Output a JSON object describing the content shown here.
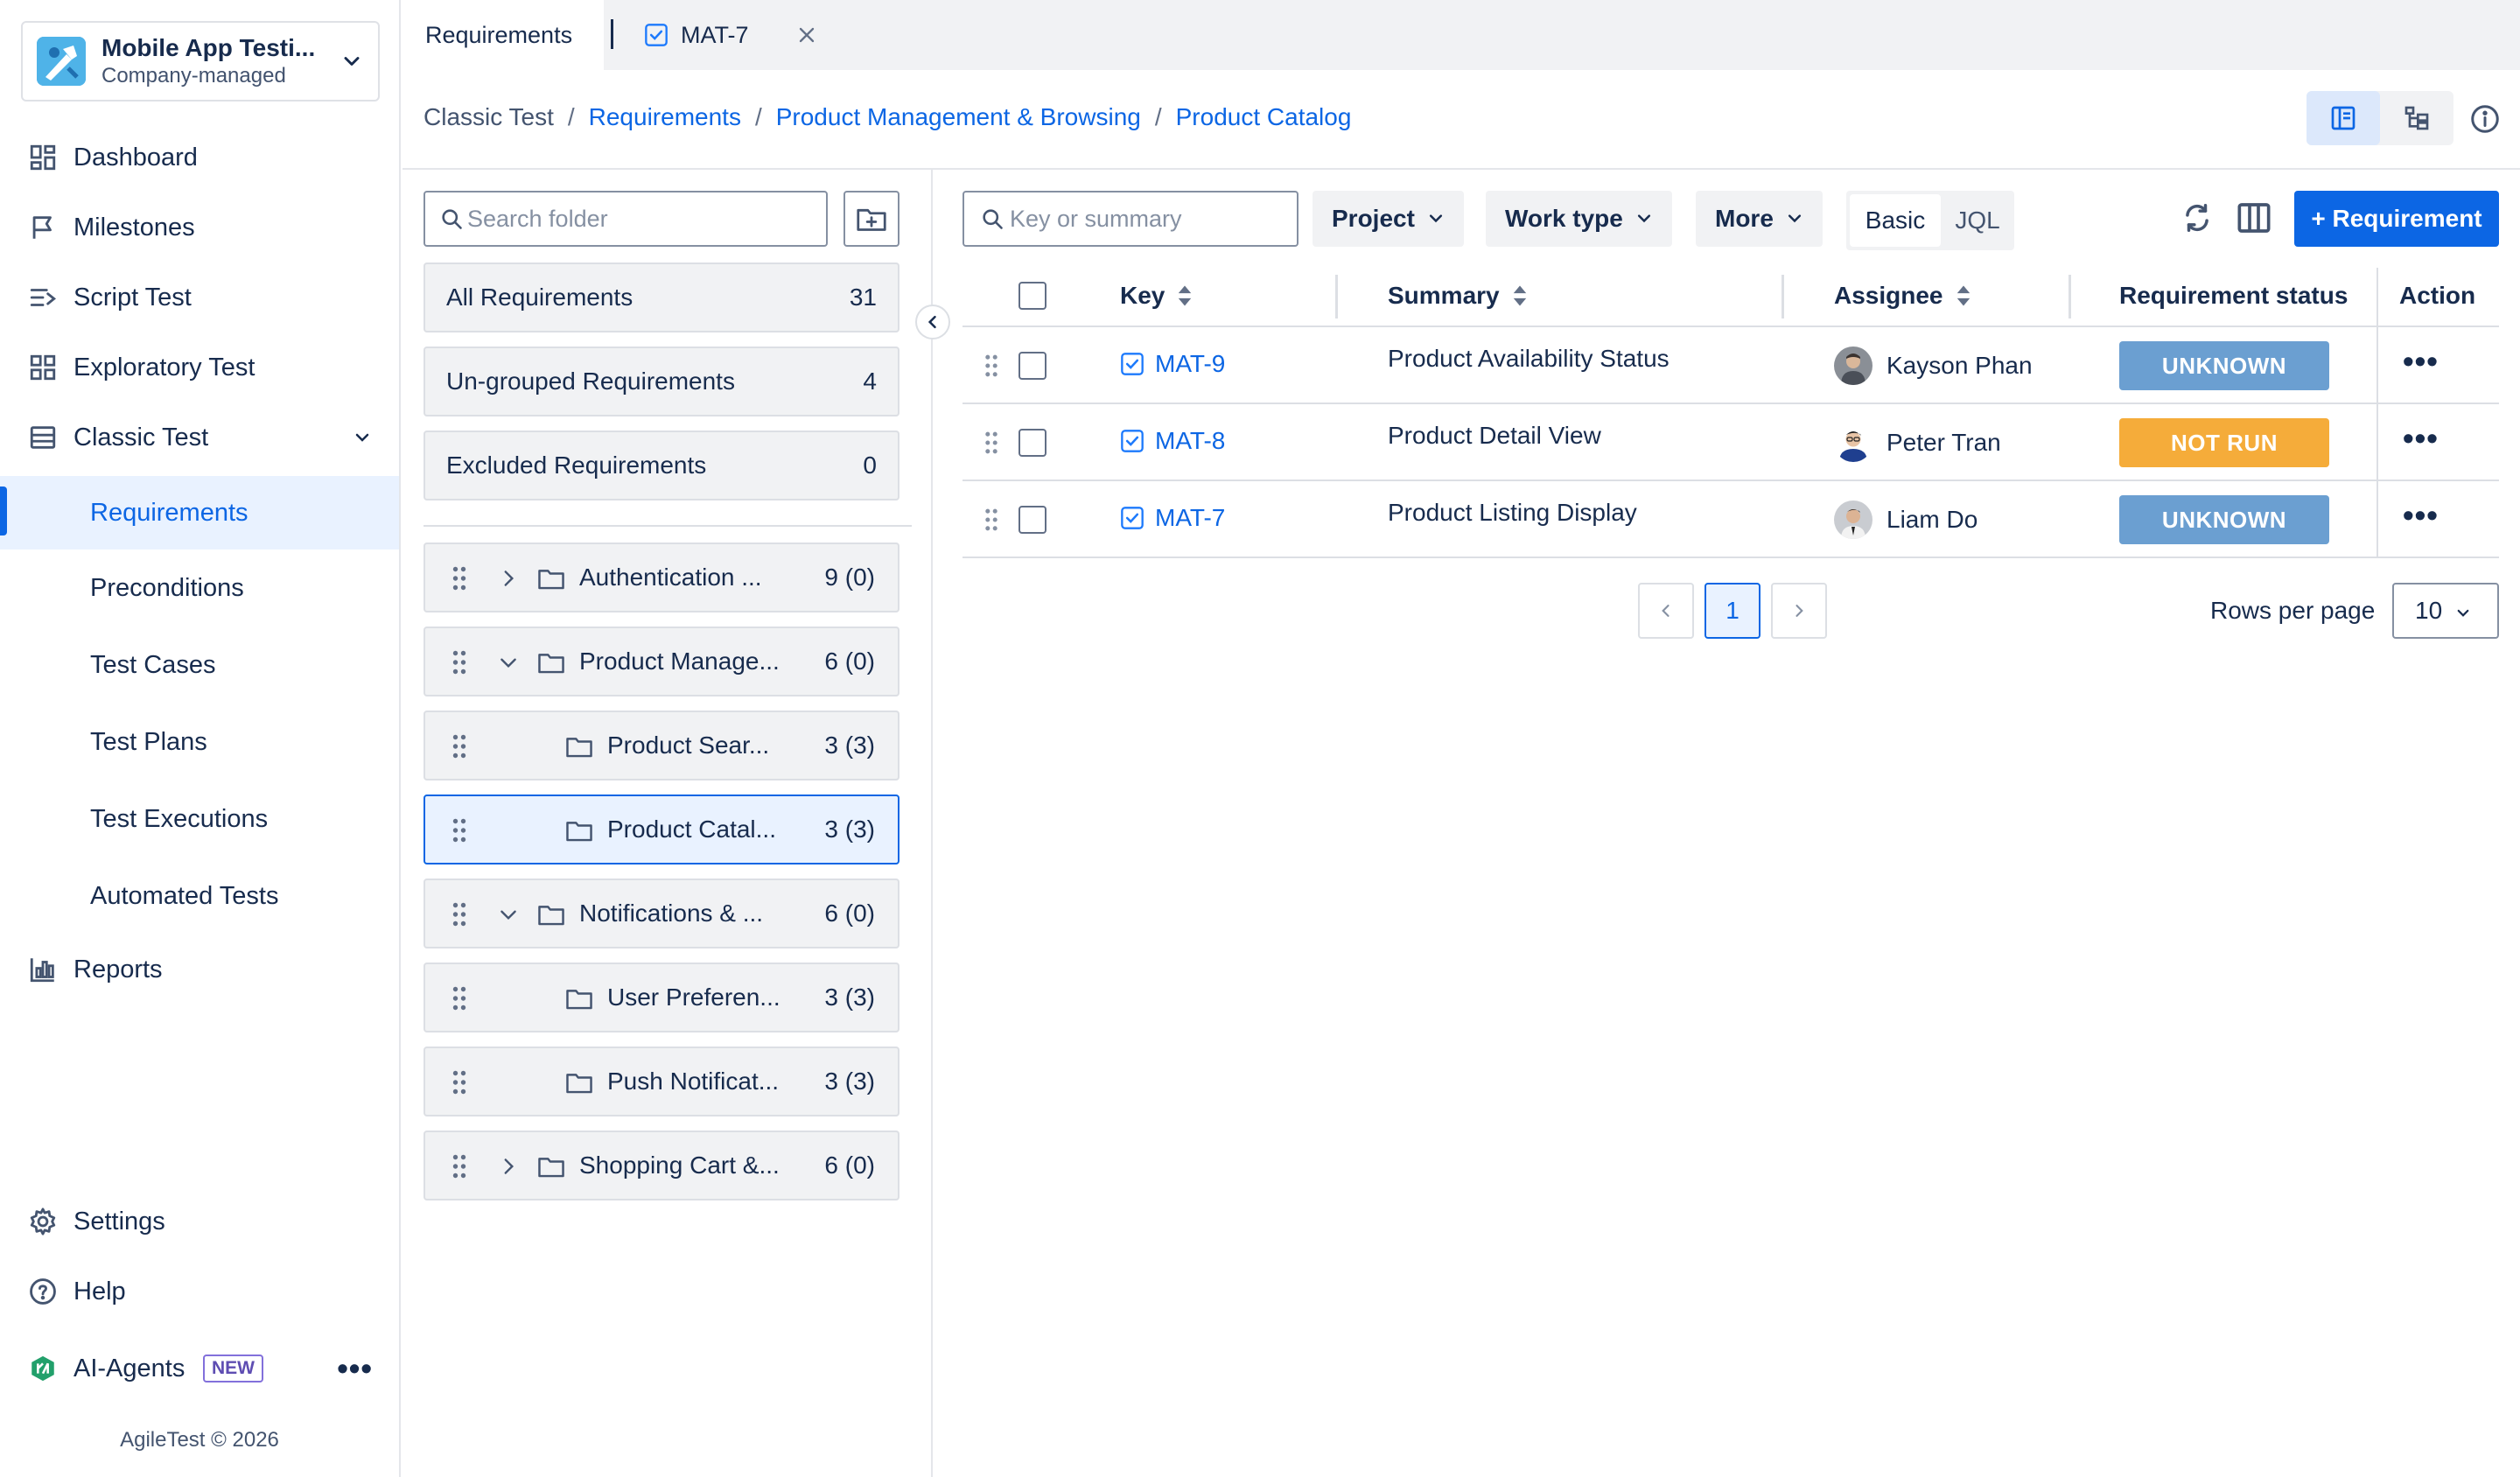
{
  "project": {
    "name": "Mobile App Testi...",
    "type": "Company-managed"
  },
  "nav": {
    "dashboard": "Dashboard",
    "milestones": "Milestones",
    "script_test": "Script Test",
    "exploratory_test": "Exploratory Test",
    "classic_test": "Classic Test",
    "requirements": "Requirements",
    "preconditions": "Preconditions",
    "test_cases": "Test Cases",
    "test_plans": "Test Plans",
    "test_executions": "Test Executions",
    "automated_tests": "Automated Tests",
    "reports": "Reports",
    "settings": "Settings",
    "help": "Help",
    "ai_agents": "AI-Agents",
    "new_badge": "NEW"
  },
  "footer": {
    "copyright": "AgileTest © 2026"
  },
  "tabs": {
    "requirements": "Requirements",
    "issue": "MAT-7"
  },
  "breadcrumb": [
    "Classic Test",
    "Requirements",
    "Product Management & Browsing",
    "Product Catalog"
  ],
  "folders": {
    "search_placeholder": "Search folder",
    "groups": [
      {
        "label": "All Requirements",
        "count": "31"
      },
      {
        "label": "Un-grouped Requirements",
        "count": "4"
      },
      {
        "label": "Excluded Requirements",
        "count": "0"
      }
    ],
    "tree": [
      {
        "name": "Authentication ...",
        "count": "9 (0)",
        "expanded": false,
        "level": 0
      },
      {
        "name": "Product Manage...",
        "count": "6 (0)",
        "expanded": true,
        "level": 0
      },
      {
        "name": "Product Sear...",
        "count": "3 (3)",
        "level": 1
      },
      {
        "name": "Product Catal...",
        "count": "3 (3)",
        "level": 1,
        "selected": true
      },
      {
        "name": "Notifications & ...",
        "count": "6 (0)",
        "expanded": true,
        "level": 0
      },
      {
        "name": "User Preferen...",
        "count": "3 (3)",
        "level": 1
      },
      {
        "name": "Push Notificat...",
        "count": "3 (3)",
        "level": 1
      },
      {
        "name": "Shopping Cart &...",
        "count": "6 (0)",
        "expanded": false,
        "level": 0
      }
    ]
  },
  "filters": {
    "search_placeholder": "Key or summary",
    "project": "Project",
    "work_type": "Work type",
    "more": "More",
    "basic": "Basic",
    "jql": "JQL",
    "add_button": "+ Requirement"
  },
  "table": {
    "columns": {
      "key": "Key",
      "summary": "Summary",
      "assignee": "Assignee",
      "status": "Requirement status",
      "action": "Action"
    },
    "rows": [
      {
        "key": "MAT-9",
        "summary": "Product Availability Status",
        "assignee": "Kayson Phan",
        "status": "UNKNOWN",
        "status_color": "#6b9fd1"
      },
      {
        "key": "MAT-8",
        "summary": "Product Detail View",
        "assignee": "Peter Tran",
        "status": "NOT RUN",
        "status_color": "#f5ac3a"
      },
      {
        "key": "MAT-7",
        "summary": "Product Listing Display",
        "assignee": "Liam Do",
        "status": "UNKNOWN",
        "status_color": "#6b9fd1"
      }
    ]
  },
  "pagination": {
    "current_page": "1",
    "rows_per_page_label": "Rows per page",
    "rows_per_page": "10"
  },
  "colors": {
    "accent": "#0c66e4",
    "selected_bg": "#e9f2ff"
  }
}
